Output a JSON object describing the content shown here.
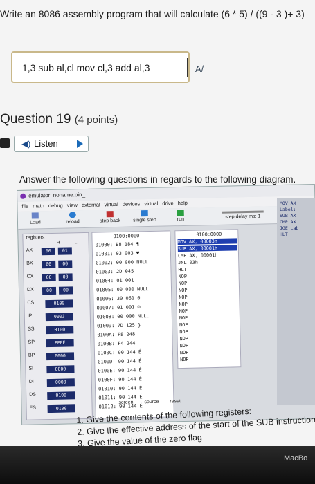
{
  "question_prompt": "Write an 8086 assembly program that will calculate (6 * 5) / ((9 - 3 )+ 3)",
  "answer_input": {
    "value": "1,3 sub al,cl mov cl,3 add al,3"
  },
  "question": {
    "title": "Question 19",
    "points": "(4 points)"
  },
  "listen": {
    "label": "Listen"
  },
  "instructions": "Answer the following questions in regards to the following diagram.",
  "emulator": {
    "window_title": "emulator: noname.bin_",
    "menu": "file math debug view external virtual devices virtual drive help",
    "toolbar": [
      "Load",
      "reload",
      "step back",
      "single step",
      "run",
      "step delay ms: 1"
    ],
    "registers": {
      "header": "registers",
      "cols": [
        "H",
        "L"
      ],
      "rows": [
        {
          "name": "AX",
          "h": "00",
          "l": "01"
        },
        {
          "name": "BX",
          "h": "00",
          "l": "00"
        },
        {
          "name": "CX",
          "h": "00",
          "l": "00"
        },
        {
          "name": "DX",
          "h": "00",
          "l": "00"
        },
        {
          "name": "CS",
          "v": "0100"
        },
        {
          "name": "IP",
          "v": "0003"
        },
        {
          "name": "SS",
          "v": "0100"
        },
        {
          "name": "SP",
          "v": "FFFE"
        },
        {
          "name": "BP",
          "v": "0000"
        },
        {
          "name": "SI",
          "v": "0000"
        },
        {
          "name": "DI",
          "v": "0000"
        },
        {
          "name": "DS",
          "v": "0100"
        },
        {
          "name": "ES",
          "v": "0100"
        }
      ]
    },
    "memory": {
      "header": "0100:0000",
      "lines": [
        "01000: B8 184 ¶",
        "01001: 03 003 ♥",
        "01002: 00 000 NULL",
        "01003: 2D 045",
        "01004: 01 001",
        "01005: 00 000 NULL",
        "01006: 30 061 0",
        "01007: 01 001 ☺",
        "01008: 00 000 NULL",
        "01009: 7D 125 }",
        "0100A: F8 248",
        "0100B: F4 244",
        "0100C: 90 144 É",
        "0100D: 90 144 É",
        "0100E: 90 144 É",
        "0100F: 90 144 É",
        "01010: 90 144 É",
        "01011: 90 144 É",
        "01012: 90 144 É"
      ]
    },
    "disasm": {
      "header": "0100:0000",
      "lines": [
        "MOV AX, 00003h",
        "SUB AX, 00001h",
        "CMP AX, 00001h",
        "JNL 03h",
        "HLT",
        "NOP",
        "NOP",
        "NOP",
        "NOP",
        "NOP",
        "NOP",
        "NOP",
        "NOP",
        "NOP",
        "NOP",
        "NOP",
        "NOP",
        "NOP"
      ]
    },
    "bottom_buttons": [
      "screen",
      "source",
      "reset"
    ],
    "side_code": [
      "MOV AX",
      "Label:",
      "SUB AX",
      "CMP AX",
      "JGE Lab",
      "HLT"
    ]
  },
  "questions": [
    "1. Give the contents of the following registers:",
    "2. Give the effective address of the start of the SUB instruction",
    "3. Give the value of the zero flag"
  ],
  "device_label": "MacBo"
}
